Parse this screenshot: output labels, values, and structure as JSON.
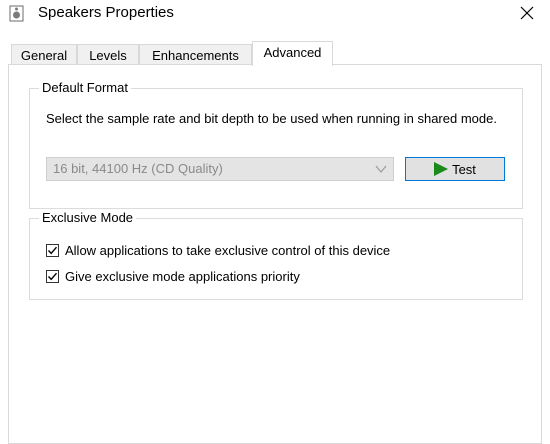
{
  "window": {
    "title": "Speakers Properties",
    "icon": "speaker-icon",
    "close_icon": "close-icon"
  },
  "tabs": [
    {
      "label": "General",
      "active": false
    },
    {
      "label": "Levels",
      "active": false
    },
    {
      "label": "Enhancements",
      "active": false
    },
    {
      "label": "Advanced",
      "active": true
    }
  ],
  "default_format": {
    "group_label": "Default Format",
    "description": "Select the sample rate and bit depth to be used when running in shared mode.",
    "select_value": "16 bit, 44100 Hz (CD Quality)",
    "select_disabled": true,
    "test_button_label": "Test",
    "test_icon": "play-icon"
  },
  "exclusive_mode": {
    "group_label": "Exclusive Mode",
    "options": [
      {
        "label": "Allow applications to take exclusive control of this device",
        "checked": true
      },
      {
        "label": "Give exclusive mode applications priority",
        "checked": true
      }
    ]
  },
  "colors": {
    "accent": "#0078d7",
    "play_green": "#1a8a1a"
  }
}
